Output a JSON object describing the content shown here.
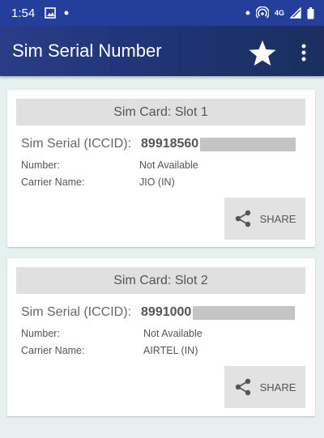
{
  "status_bar": {
    "time": "1:54",
    "network_label": "4G",
    "icons": [
      "gallery-notification-icon",
      "dot-notification-icon",
      "hotspot-icon",
      "signal-icon",
      "battery-icon"
    ]
  },
  "app_bar": {
    "title": "Sim Serial Number",
    "icons": [
      "star-icon",
      "more-vert-icon"
    ]
  },
  "cards": [
    {
      "header": "Sim Card: Slot 1",
      "serial_label": "Sim Serial (ICCID):",
      "serial_value": "89918560",
      "number_label": "Number:",
      "number_value": "Not Available",
      "carrier_label": "Carrier Name:",
      "carrier_value": "JIO (IN)",
      "share_label": "SHARE"
    },
    {
      "header": "Sim Card: Slot 2",
      "serial_label": "Sim Serial (ICCID):",
      "serial_value": "8991000",
      "number_label": "Number:",
      "number_value": "Not Available",
      "carrier_label": "Carrier Name:",
      "carrier_value": "AIRTEL (IN)",
      "share_label": "SHARE"
    }
  ],
  "colors": {
    "status_bar": "#243e9c",
    "app_bar": "#1f3577",
    "background": "#e6f1ef",
    "card_header": "#e0e0e0",
    "share_button": "#e2e2e2"
  }
}
